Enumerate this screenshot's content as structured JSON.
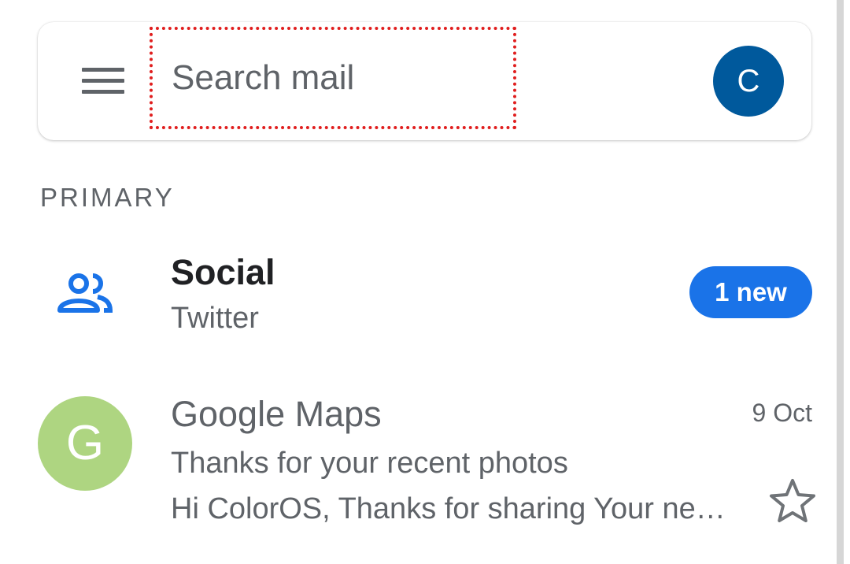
{
  "search": {
    "placeholder": "Search mail"
  },
  "account": {
    "initial": "C",
    "color": "#00599c"
  },
  "section": {
    "label": "PRIMARY"
  },
  "social": {
    "icon": "people-icon",
    "title": "Social",
    "subtitle": "Twitter",
    "badge": "1 new",
    "accent": "#1a73e8"
  },
  "messages": [
    {
      "avatar_initial": "G",
      "avatar_color": "#aed581",
      "sender": "Google Maps",
      "date": "9 Oct",
      "subject": "Thanks for your recent photos",
      "snippet": "Hi ColorOS, Thanks for sharing Your ne…",
      "star_icon": "star-outline-icon"
    }
  ]
}
